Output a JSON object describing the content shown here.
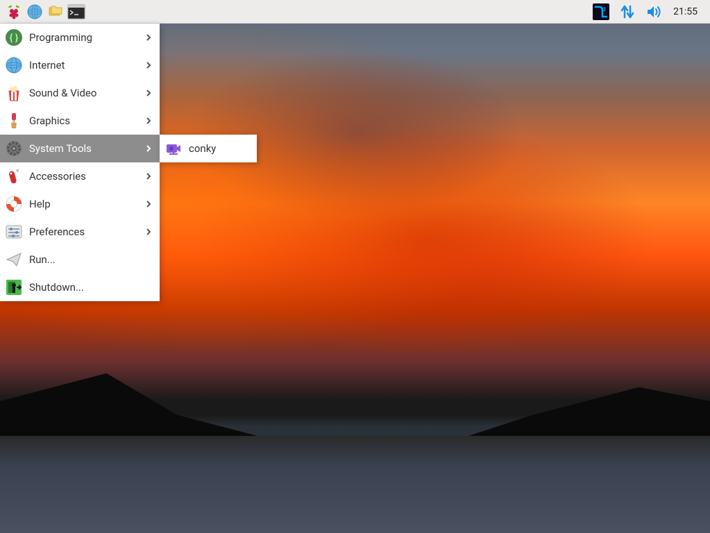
{
  "taskbar": {
    "clock": "21:55"
  },
  "menu": {
    "items": [
      {
        "label": "Programming",
        "icon": "braces",
        "arrow": true
      },
      {
        "label": "Internet",
        "icon": "globe",
        "arrow": true
      },
      {
        "label": "Sound & Video",
        "icon": "popcorn",
        "arrow": true
      },
      {
        "label": "Graphics",
        "icon": "brush",
        "arrow": true
      },
      {
        "label": "System Tools",
        "icon": "gear",
        "arrow": true,
        "highlighted": true
      },
      {
        "label": "Accessories",
        "icon": "swissknife",
        "arrow": true
      },
      {
        "label": "Help",
        "icon": "lifebuoy",
        "arrow": true
      },
      {
        "label": "Preferences",
        "icon": "sliders",
        "arrow": true
      },
      {
        "label": "Run...",
        "icon": "paperplane",
        "arrow": false
      },
      {
        "label": "Shutdown...",
        "icon": "exit",
        "arrow": false
      }
    ]
  },
  "submenu": {
    "items": [
      {
        "label": "conky",
        "icon": "camera"
      }
    ]
  }
}
